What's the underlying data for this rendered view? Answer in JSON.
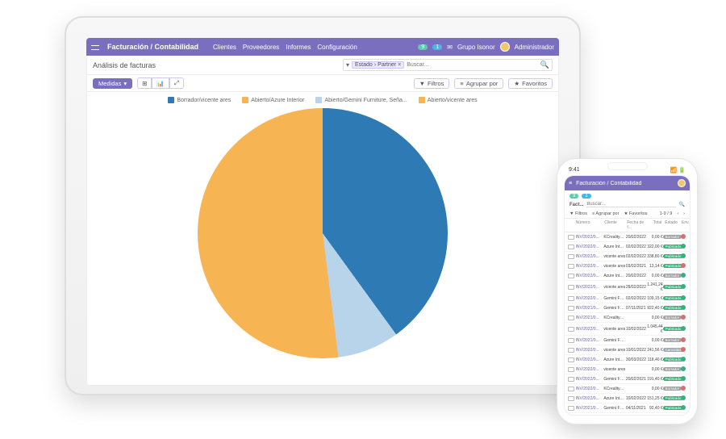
{
  "colors": {
    "accent": "#7a6fbe",
    "blue": "#2d7ab5",
    "lightblue": "#b8d4ea",
    "orange": "#f6b552",
    "teal_pill": "#5ecab0",
    "blue_pill": "#4bb5e8"
  },
  "laptop": {
    "brand": "Facturación / Contabilidad",
    "menu": [
      "Clientes",
      "Proveedores",
      "Informes",
      "Configuración"
    ],
    "right_badges": [
      "9",
      "1"
    ],
    "org": "Grupo Isonor",
    "user": "Administrador",
    "subtitle": "Análisis de facturas",
    "search_chip1": "Estado",
    "search_chip2": "Partner",
    "search_placeholder": "Buscar...",
    "measures_btn": "Medidas",
    "filters_btn": "Filtros",
    "group_btn": "Agrupar por",
    "fav_btn": "Favoritos",
    "legend": [
      {
        "label": "Borrador/vicente ares",
        "color": "#2d7ab5"
      },
      {
        "label": "Abierto/Azure Interior",
        "color": "#f6b552"
      },
      {
        "label": "Abierto/Gemini Furniture, Seña...",
        "color": "#b8d4ea"
      },
      {
        "label": "Abierto/vicente ares",
        "color": "#f6b552"
      }
    ]
  },
  "chart_data": {
    "type": "pie",
    "title": "Análisis de facturas",
    "series": [
      {
        "name": "Borrador/vicente ares",
        "value": 40,
        "color": "#2d7ab5"
      },
      {
        "name": "Abierto/Gemini Furniture, Seña...",
        "value": 8,
        "color": "#b8d4ea"
      },
      {
        "name": "Abierto/Azure Interior + Abierto/vicente ares",
        "value": 52,
        "color": "#f6b552"
      }
    ]
  },
  "phone": {
    "time": "9:41",
    "brand": "Facturación / Contabilidad",
    "badges": [
      "9",
      "1"
    ],
    "list_title": "Fact...",
    "search_placeholder": "Buscar...",
    "filters": "Filtros",
    "group": "Agrupar por",
    "fav": "Favoritos",
    "pager": "1-9 / 9",
    "cols": {
      "num": "Número",
      "cli": "Cliente",
      "fec": "Fecha de f...",
      "tot": "Total",
      "est": "Estado",
      "env": "Env..."
    },
    "rows": [
      {
        "num": "INV/2022/0...",
        "cli": "KCrealitys p...",
        "fec": "20/02/2022",
        "tot": "0,00 €",
        "est": "Borrador",
        "estc": "b-draft",
        "env": "d-red"
      },
      {
        "num": "INV/2022/0...",
        "cli": "Azure Interior",
        "fec": "02/02/2022",
        "tot": "322,00 €",
        "est": "Publicado",
        "estc": "b-pub",
        "env": "d-green"
      },
      {
        "num": "INV/2022/0...",
        "cli": "vicente ares",
        "fec": "02/02/2022",
        "tot": "338,80 €",
        "est": "Publicado",
        "estc": "b-pub",
        "env": "d-green"
      },
      {
        "num": "INV/2022/0...",
        "cli": "vicente ares",
        "fec": "03/02/2021",
        "tot": "13,14 €",
        "est": "Publicado",
        "estc": "b-pub",
        "env": "d-red"
      },
      {
        "num": "INV/2022/0...",
        "cli": "Azure Interior",
        "fec": "20/02/2022",
        "tot": "0,00 €",
        "est": "Borrador",
        "estc": "b-draft",
        "env": "d-green"
      },
      {
        "num": "INV/2022/0...",
        "cli": "vicente ares",
        "fec": "28/02/2022",
        "tot": "1.241,24 €",
        "est": "Publicado",
        "estc": "b-pub",
        "env": "d-green"
      },
      {
        "num": "INV/2022/0...",
        "cli": "Gemini Furn...",
        "fec": "02/02/2022",
        "tot": "109,15 €",
        "est": "Publicado",
        "estc": "b-pub",
        "env": "d-green"
      },
      {
        "num": "INV/2021/0...",
        "cli": "Gemini Furn...",
        "fec": "07/11/2021",
        "tot": "922,40 €",
        "est": "Publicado",
        "estc": "b-pub",
        "env": "d-green"
      },
      {
        "num": "INV/2021/0...",
        "cli": "KCrealitys p...",
        "fec": "",
        "tot": "0,00 €",
        "est": "Borrador",
        "estc": "b-draft",
        "env": "d-red"
      },
      {
        "num": "INV/2022/0...",
        "cli": "vicente ares",
        "fec": "10/02/2022",
        "tot": "1.045,44 €",
        "est": "Publicado",
        "estc": "b-pub",
        "env": "d-green"
      },
      {
        "num": "INV/2021/0...",
        "cli": "Gemini Furn...",
        "fec": "",
        "tot": "0,00 €",
        "est": "Borrador",
        "estc": "b-draft",
        "env": "d-red"
      },
      {
        "num": "INV/2022/0...",
        "cli": "vicente ares",
        "fec": "10/01/2022",
        "tot": "241,56 €",
        "est": "Cancelado",
        "estc": "b-cancel",
        "env": "d-red"
      },
      {
        "num": "INV/2022/0...",
        "cli": "Azure Interior",
        "fec": "30/03/2022",
        "tot": "118,40 €",
        "est": "Publicado",
        "estc": "b-pub",
        "env": "d-green"
      },
      {
        "num": "INV/2022/0...",
        "cli": "vicente ares",
        "fec": "",
        "tot": "0,00 €",
        "est": "Borrador",
        "estc": "b-draft",
        "env": "d-green"
      },
      {
        "num": "INV/2022/0...",
        "cli": "Gemini Furn...",
        "fec": "20/02/2021",
        "tot": "191,40 €",
        "est": "Publicado",
        "estc": "b-pub",
        "env": "d-green"
      },
      {
        "num": "INV/2022/0...",
        "cli": "KCrealitys p...",
        "fec": "",
        "tot": "0,00 €",
        "est": "Borrador",
        "estc": "b-draft",
        "env": "d-red"
      },
      {
        "num": "INV/2022/0...",
        "cli": "Azure Interior",
        "fec": "10/02/2022",
        "tot": "151,25 €",
        "est": "Publicado",
        "estc": "b-pub",
        "env": "d-green"
      },
      {
        "num": "INV/2021/0...",
        "cli": "Gemini Furn...",
        "fec": "04/11/2021",
        "tot": "92,40 €",
        "est": "Publicado",
        "estc": "b-pub",
        "env": "d-green"
      }
    ]
  }
}
